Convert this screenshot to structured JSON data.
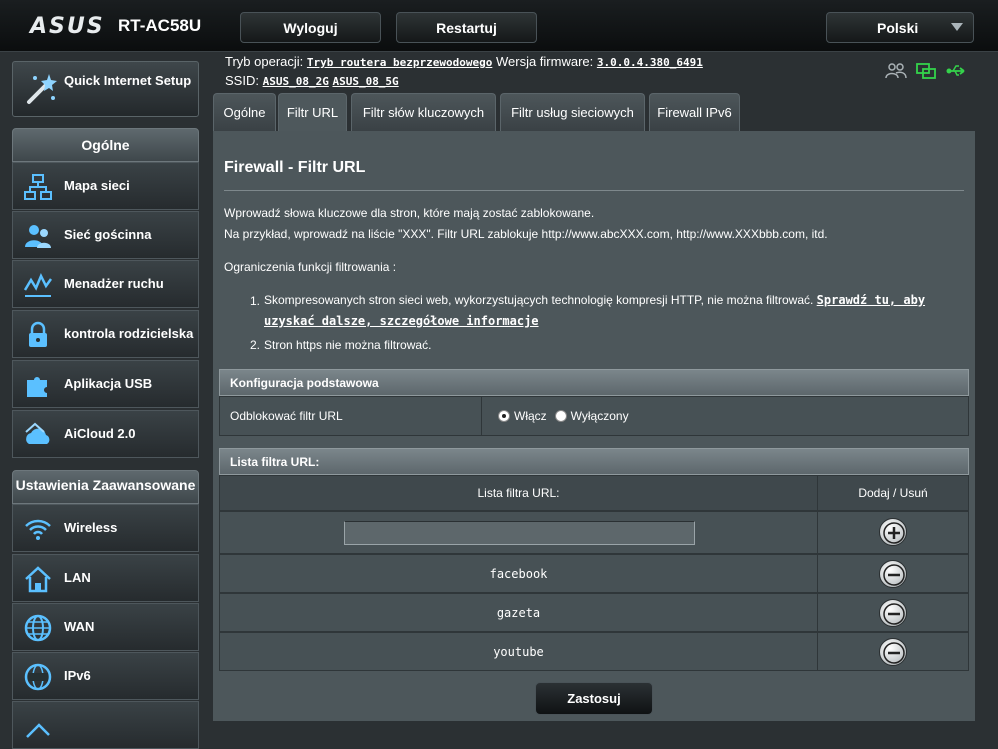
{
  "header": {
    "brand": "ASUS",
    "model": "RT-AC58U",
    "logout_label": "Wyloguj",
    "restart_label": "Restartuj",
    "language": "Polski"
  },
  "status": {
    "mode_label": "Tryb operacji:",
    "mode_value": "Tryb routera bezprzewodowego",
    "firmware_label": "Wersja firmware:",
    "firmware_value": "3.0.0.4.380_6491",
    "ssid_label": "SSID:",
    "ssid_2g": "ASUS_08_2G",
    "ssid_5g": "ASUS_08_5G"
  },
  "sidebar": {
    "quick_setup": "Quick Internet Setup",
    "general_header": "Ogólne",
    "general_items": [
      {
        "label": "Mapa sieci",
        "icon": "network-map-icon"
      },
      {
        "label": "Sieć gościnna",
        "icon": "guest-network-icon"
      },
      {
        "label": "Menadżer ruchu",
        "icon": "traffic-manager-icon"
      },
      {
        "label": "kontrola rodzicielska",
        "icon": "parental-control-icon"
      },
      {
        "label": "Aplikacja USB",
        "icon": "usb-application-icon"
      },
      {
        "label": "AiCloud 2.0",
        "icon": "aicloud-icon"
      }
    ],
    "advanced_header": "Ustawienia Zaawansowane",
    "advanced_items": [
      {
        "label": "Wireless",
        "icon": "wireless-icon"
      },
      {
        "label": "LAN",
        "icon": "lan-icon"
      },
      {
        "label": "WAN",
        "icon": "wan-icon"
      },
      {
        "label": "IPv6",
        "icon": "ipv6-icon"
      }
    ]
  },
  "tabs": [
    {
      "label": "Ogólne"
    },
    {
      "label": "Filtr URL"
    },
    {
      "label": "Filtr słów kluczowych"
    },
    {
      "label": "Filtr usług sieciowych"
    },
    {
      "label": "Firewall IPv6"
    }
  ],
  "main": {
    "title": "Firewall - Filtr URL",
    "desc1": "Wprowadź słowa kluczowe dla stron, które mają zostać zablokowane.",
    "desc2": "Na przykład, wprowadź na liście \"XXX\". Filtr URL zablokuje http://www.abcXXX.com, http://www.XXXbbb.com, itd.",
    "limits_title": "Ograniczenia funkcji filtrowania :",
    "note1_num": "1.",
    "note1_text": "Skompresowanych stron sieci web, wykorzystujących technologię kompresji HTTP, nie można filtrować.",
    "note1_link_part1": "Sprawdź tu, aby",
    "note1_link_part2": "uzyskać dalsze, szczegółowe informacje",
    "note2_num": "2.",
    "note2_text": "Stron https nie można filtrować.",
    "basic_config_header": "Konfiguracja podstawowa",
    "enable_label": "Odblokować filtr URL",
    "radio_on": "Włącz",
    "radio_off": "Wyłączony",
    "url_list_header": "Lista filtra URL:",
    "col_url": "Lista filtra URL:",
    "col_action": "Dodaj / Usuń",
    "url_input_value": "",
    "urls": [
      "facebook",
      "gazeta",
      "youtube"
    ],
    "apply_label": "Zastosuj"
  }
}
